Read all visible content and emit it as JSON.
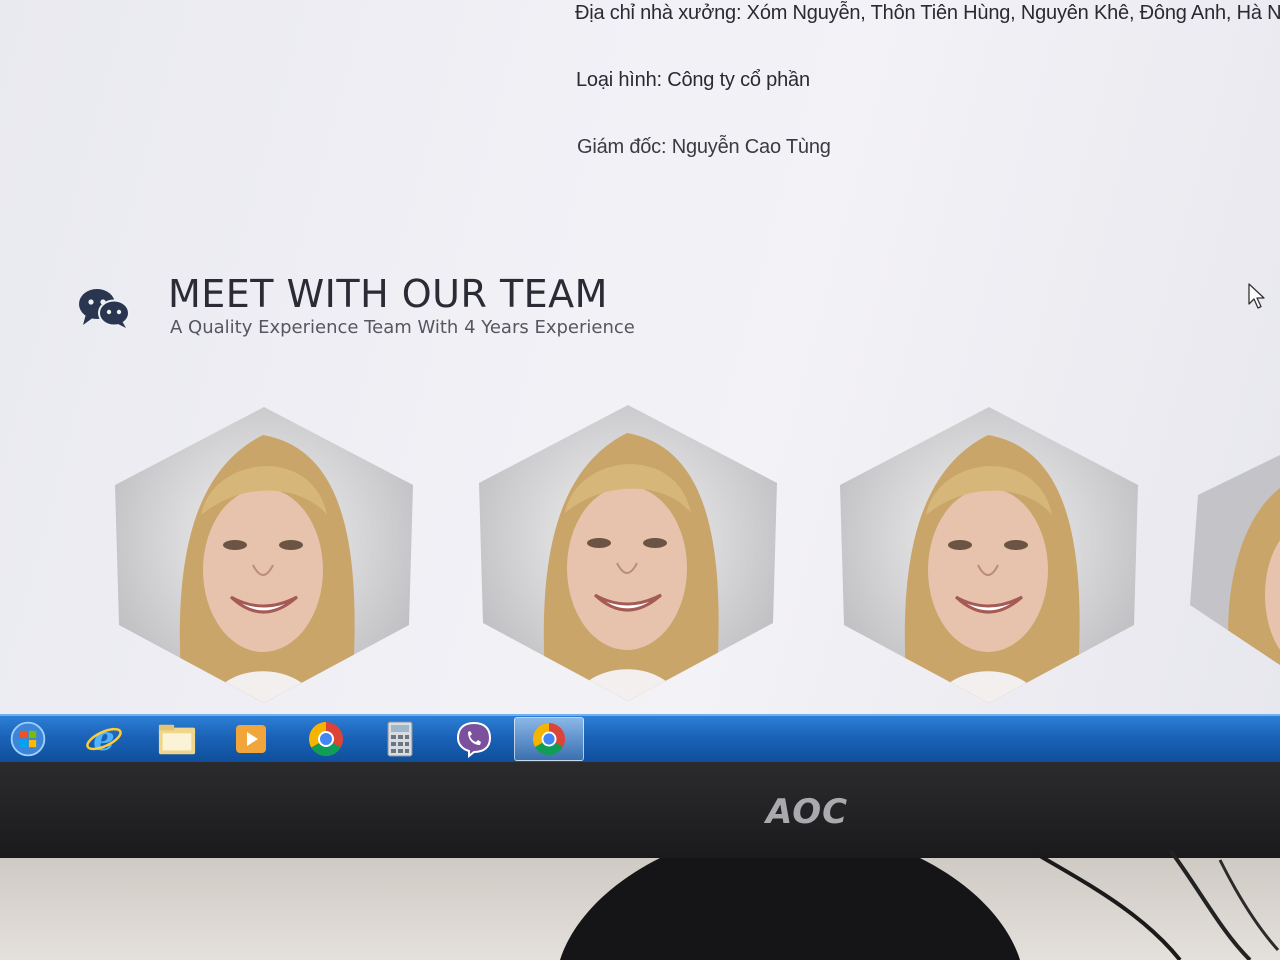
{
  "company_info": {
    "address": "Địa chỉ nhà xưởng: Xóm Nguyễn, Thôn Tiên Hùng, Nguyên Khê, Đông Anh, Hà Nội",
    "type": "Loại hình: Công ty cổ phần",
    "director": "Giám đốc: Nguyễn Cao Tùng"
  },
  "team": {
    "title": "MEET WITH OUR TEAM",
    "subtitle": "A Quality Experience Team With 4 Years Experience",
    "icon": "chat-bubbles-icon",
    "members": [
      {
        "photo": "team-member-photo"
      },
      {
        "photo": "team-member-photo"
      },
      {
        "photo": "team-member-photo"
      },
      {
        "photo": "team-member-photo"
      }
    ]
  },
  "taskbar": {
    "items": [
      {
        "icon": "windows-start-icon"
      },
      {
        "icon": "internet-explorer-icon"
      },
      {
        "icon": "file-explorer-icon"
      },
      {
        "icon": "media-player-icon"
      },
      {
        "icon": "chrome-icon"
      },
      {
        "icon": "calculator-icon"
      },
      {
        "icon": "viber-icon"
      },
      {
        "icon": "chrome-active-icon"
      }
    ]
  },
  "monitor": {
    "brand": "AOC"
  },
  "colors": {
    "taskbar": "#1b63b8",
    "title": "#2b2b36",
    "icon": "#2a3550"
  }
}
